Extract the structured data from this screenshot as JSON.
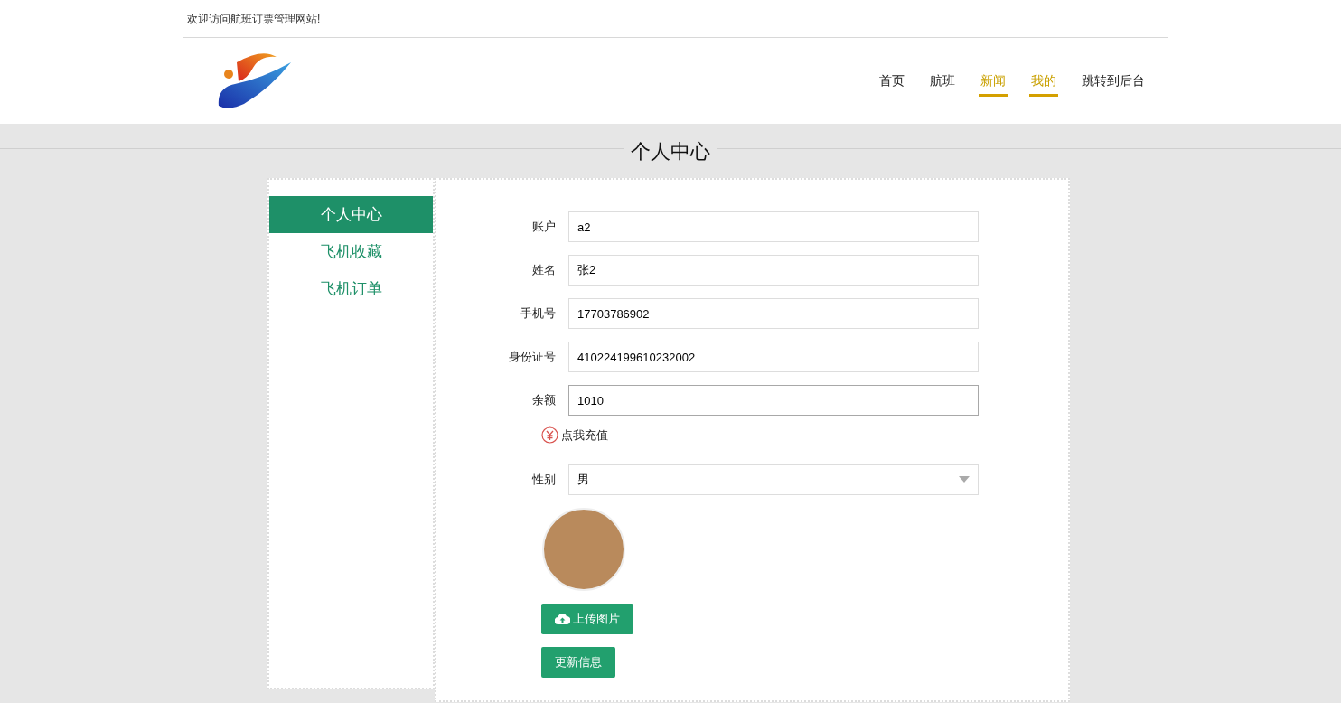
{
  "top_bar": {
    "welcome": "欢迎访问航班订票管理网站!"
  },
  "nav": [
    {
      "label": "首页",
      "selected": false
    },
    {
      "label": "航班",
      "selected": false
    },
    {
      "label": "新闻",
      "selected": true
    },
    {
      "label": "我的",
      "selected": true
    },
    {
      "label": "跳转到后台",
      "selected": false
    }
  ],
  "page_title": {
    "title": "个人中心"
  },
  "sidebar": {
    "items": [
      {
        "label": "个人中心",
        "selected": true
      },
      {
        "label": "飞机收藏",
        "selected": false
      },
      {
        "label": "飞机订单",
        "selected": false
      }
    ]
  },
  "form": {
    "fields": [
      {
        "label": "账户",
        "value": "a2",
        "focused": false
      },
      {
        "label": "姓名",
        "value": "张2",
        "focused": false
      },
      {
        "label": "手机号",
        "value": "17703786902",
        "focused": false
      },
      {
        "label": "身份证号",
        "value": "410224199610232002",
        "focused": false
      },
      {
        "label": "余额",
        "value": "1010",
        "focused": true
      }
    ],
    "recharge_link": "点我充值",
    "gender": {
      "label": "性别",
      "value": "男"
    },
    "buttons": [
      {
        "label": "上传图片",
        "kind": "upload"
      },
      {
        "label": "更新信息",
        "kind": "plain"
      }
    ]
  }
}
